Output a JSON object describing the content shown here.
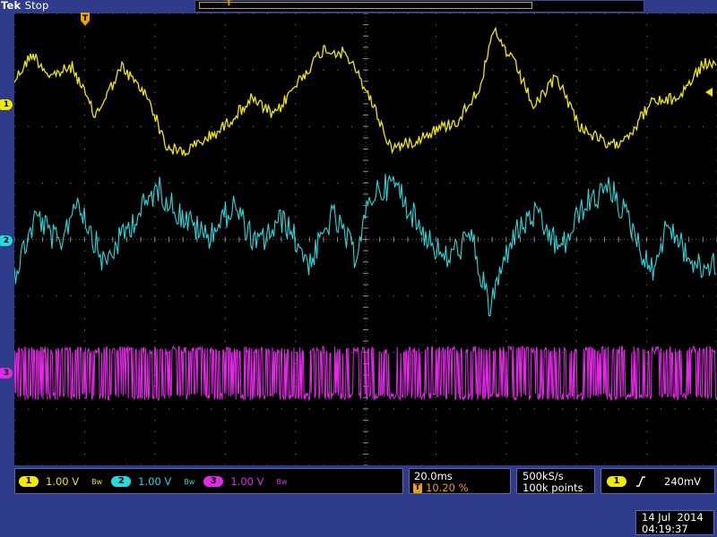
{
  "brand": {
    "name": "Tek",
    "state": "Stop"
  },
  "colors": {
    "ch1": "#f2e800",
    "ch2": "#27d8dc",
    "ch3": "#e22ae6",
    "trigger": "#f0a000",
    "frame": "#2f3c8c"
  },
  "icons": {
    "trigger_position": "T-marker",
    "trigger_level": "left-arrow",
    "edge": "rising-edge",
    "bandwidth": "bw-limit"
  },
  "markers": {
    "trigger": "T",
    "ch1": "1",
    "ch2": "2",
    "ch3": "3"
  },
  "channels": [
    {
      "id": "1",
      "scale": "1.00 V",
      "bw": "Bw"
    },
    {
      "id": "2",
      "scale": "1.00 V",
      "bw": "Bw"
    },
    {
      "id": "3",
      "scale": "1.00 V",
      "bw": "Bw"
    }
  ],
  "horizontal": {
    "scale": "20.0ms",
    "trigger_pos_label": "T",
    "trigger_pos": "10.20 %"
  },
  "acquisition": {
    "rate": "500kS/s",
    "points": "100k points"
  },
  "trigger": {
    "source": "1",
    "level": "240mV"
  },
  "datetime": {
    "date": "14 Jul  2014",
    "time": "04:19:37"
  }
}
